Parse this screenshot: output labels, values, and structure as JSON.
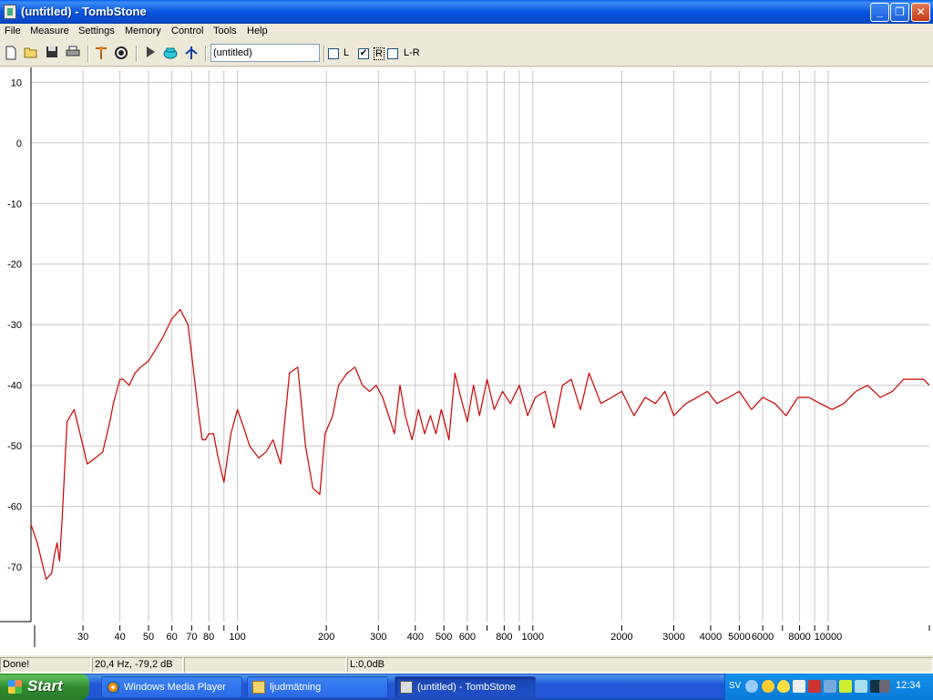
{
  "window": {
    "title": "(untitled) - TombStone",
    "min_symbol": "_",
    "max_symbol": "❐",
    "close_symbol": "✕"
  },
  "menu": [
    "File",
    "Measure",
    "Settings",
    "Memory",
    "Control",
    "Tools",
    "Help"
  ],
  "toolbar": {
    "name_value": "(untitled)",
    "channels": [
      {
        "label": "L",
        "checked": false
      },
      {
        "label": "R",
        "checked": true
      },
      {
        "label": "L-R",
        "checked": false
      }
    ],
    "icons": [
      "new-file-icon",
      "open-folder-icon",
      "save-icon",
      "print-icon",
      "microphone-icon",
      "speaker-icon",
      "play-icon",
      "record-icon",
      "cursor-icon"
    ]
  },
  "chart_data": {
    "type": "line",
    "x_scale": "log",
    "xlim": [
      20,
      22000
    ],
    "ylim": [
      -79,
      12
    ],
    "y_ticks": [
      10,
      0,
      -10,
      -20,
      -30,
      -40,
      -50,
      -60,
      -70
    ],
    "x_ticks": [
      30,
      40,
      50,
      60,
      70,
      80,
      100,
      200,
      300,
      400,
      500,
      600,
      800,
      1000,
      2000,
      3000,
      4000,
      5000,
      6000,
      8000,
      10000
    ],
    "x_gridlines": [
      30,
      40,
      50,
      60,
      70,
      80,
      90,
      100,
      200,
      300,
      400,
      500,
      600,
      700,
      800,
      900,
      1000,
      2000,
      3000,
      4000,
      5000,
      6000,
      7000,
      8000,
      9000,
      10000
    ],
    "line_color": "#cc0000",
    "series": [
      {
        "x": [
          20,
          21,
          22,
          22.5,
          23.5,
          24,
          24.5,
          25,
          25.5,
          26.5,
          28,
          30,
          31,
          33,
          35,
          37,
          38,
          40,
          41,
          43,
          45,
          47,
          50,
          53,
          56,
          60,
          64,
          68,
          70,
          72,
          74,
          76,
          78,
          80,
          83,
          86,
          90,
          95,
          100,
          105,
          110,
          118,
          125,
          132,
          140,
          150,
          160,
          170,
          180,
          190,
          198,
          210,
          220,
          235,
          250,
          265,
          280,
          295,
          310,
          325,
          340,
          355,
          370,
          390,
          410,
          430,
          450,
          470,
          490,
          520,
          545,
          570,
          600,
          630,
          660,
          700,
          740,
          790,
          840,
          900,
          960,
          1020,
          1100,
          1180,
          1260,
          1350,
          1450,
          1550,
          1700,
          1850,
          2000,
          2200,
          2400,
          2600,
          2800,
          3000,
          3300,
          3600,
          3900,
          4200,
          4600,
          5000,
          5500,
          6000,
          6600,
          7200,
          7900,
          8600,
          9400,
          10300,
          11300,
          12400,
          13600,
          15000,
          16500,
          18000,
          19500,
          21000,
          22000
        ],
        "y": [
          -63,
          -66,
          -70,
          -72,
          -71,
          -68,
          -66,
          -69,
          -62,
          -46,
          -44,
          -50,
          -53,
          -52,
          -51,
          -46,
          -43,
          -39,
          -39,
          -40,
          -38,
          -37,
          -36,
          -34,
          -32,
          -29,
          -27.5,
          -30,
          -35,
          -40,
          -45,
          -49,
          -49,
          -48,
          -48,
          -52,
          -56,
          -48,
          -44,
          -47,
          -50,
          -52,
          -51,
          -49,
          -53,
          -38,
          -37,
          -50,
          -57,
          -58,
          -48,
          -45,
          -40,
          -38,
          -37,
          -40,
          -41,
          -40,
          -42,
          -45,
          -48,
          -40,
          -45,
          -49,
          -44,
          -48,
          -45,
          -48,
          -44,
          -49,
          -38,
          -42,
          -46,
          -40,
          -45,
          -39,
          -44,
          -41,
          -43,
          -40,
          -45,
          -42,
          -41,
          -47,
          -40,
          -39,
          -44,
          -38,
          -43,
          -42,
          -41,
          -45,
          -42,
          -43,
          -41,
          -45,
          -43,
          -42,
          -41,
          -43,
          -42,
          -41,
          -44,
          -42,
          -43,
          -45,
          -42,
          -42,
          -43,
          -44,
          -43,
          -41,
          -40,
          -42,
          -41,
          -39,
          -39,
          -39,
          -40
        ]
      }
    ]
  },
  "status": {
    "state": "Done!",
    "cursor": "20,4 Hz, -79,2 dB",
    "level": "L:0,0dB"
  },
  "taskbar": {
    "start_label": "Start",
    "tasks": [
      {
        "label": "Windows Media Player",
        "active": false
      },
      {
        "label": "ljudmätning",
        "active": false
      },
      {
        "label": "(untitled) - TombStone",
        "active": true
      }
    ],
    "language": "SV",
    "clock": "12:34"
  }
}
